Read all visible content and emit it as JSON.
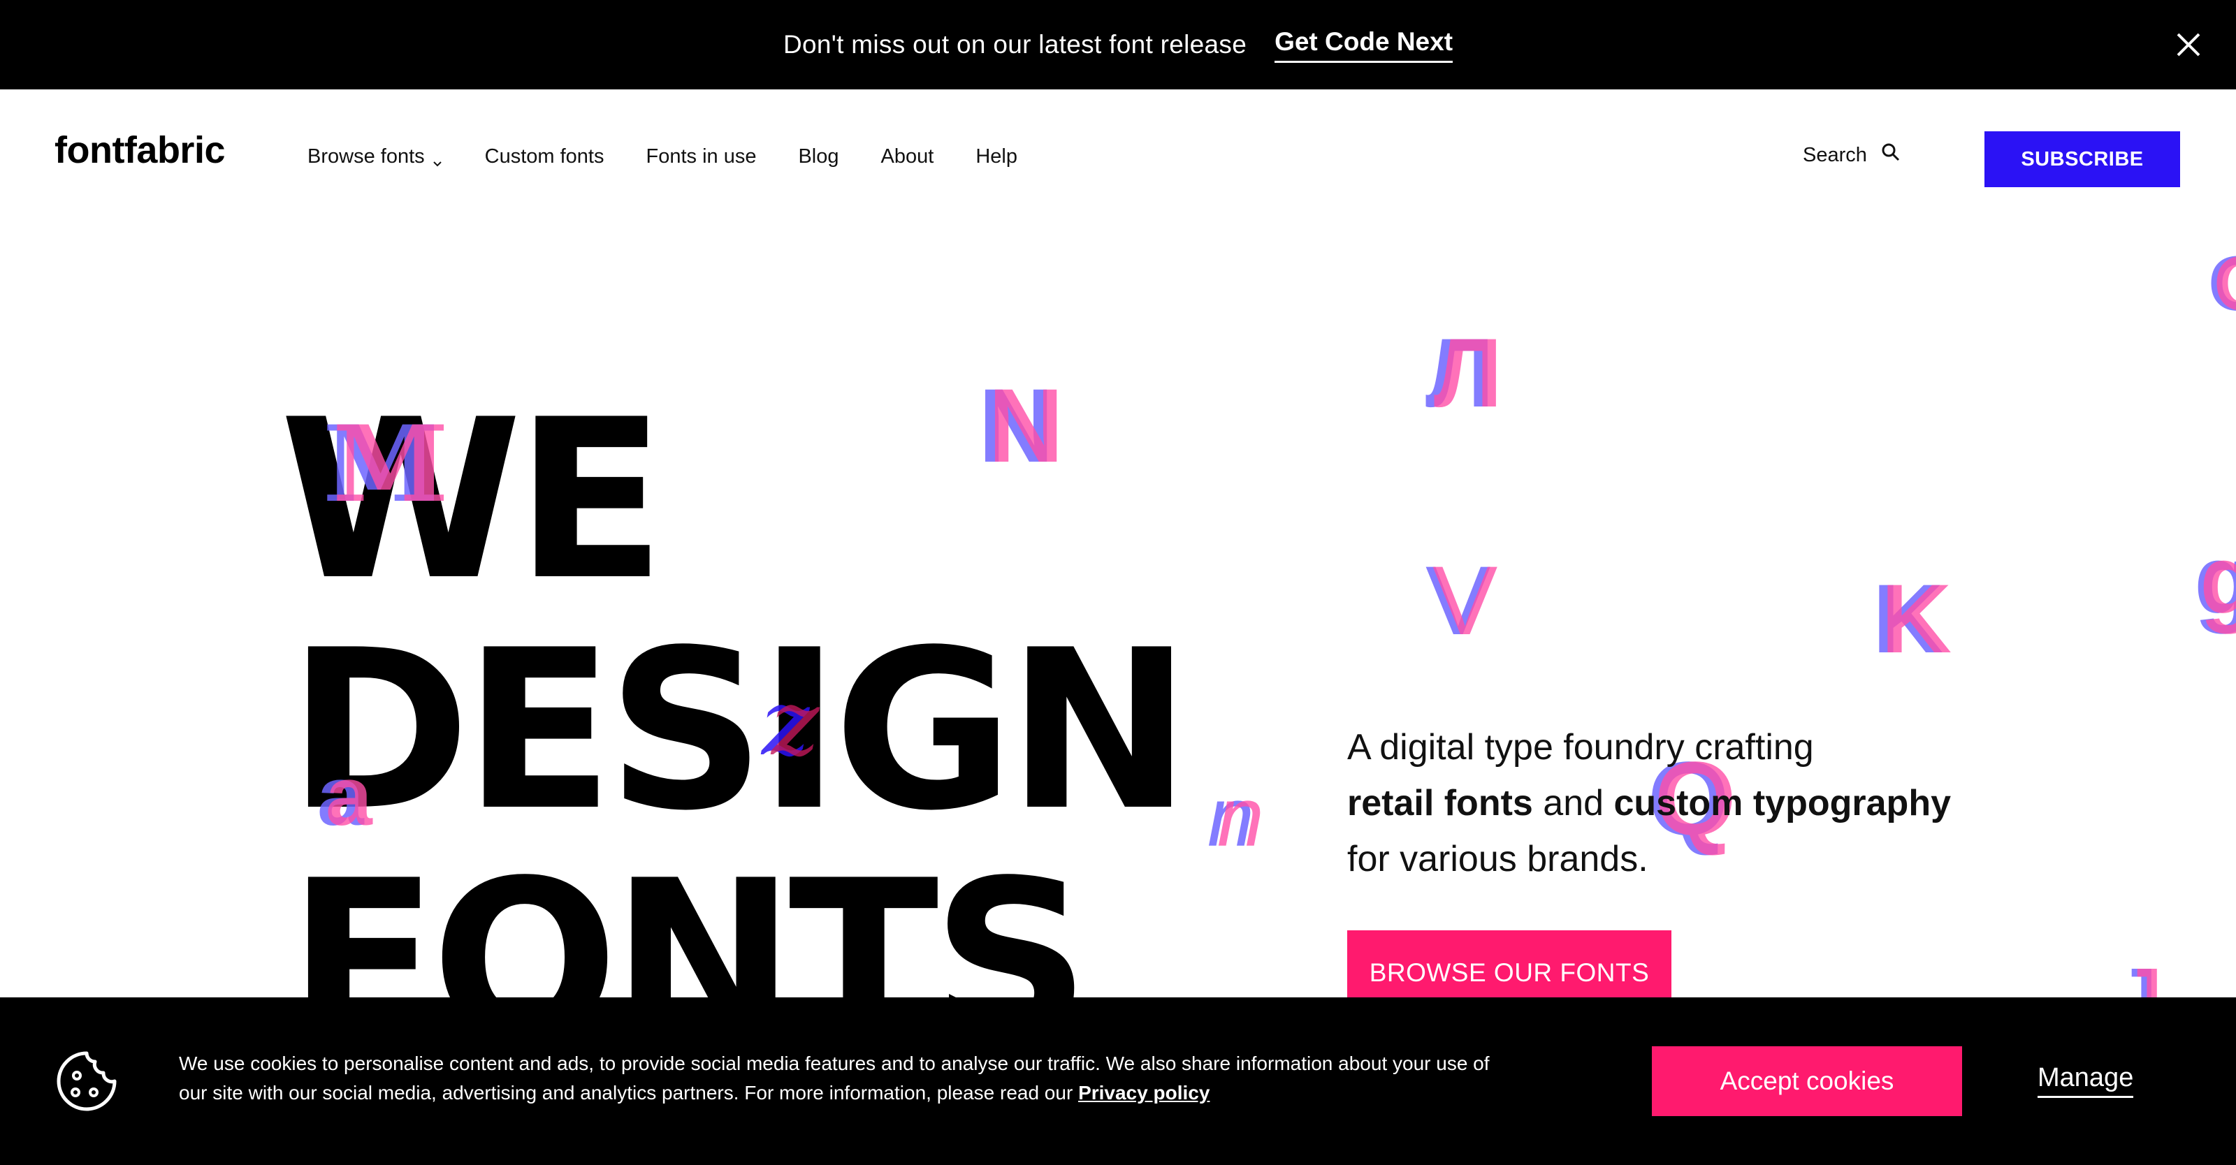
{
  "announcement": {
    "text": "Don't miss out on our latest font release",
    "link": "Get Code Next"
  },
  "header": {
    "logo": "fontfabric",
    "nav": [
      "Browse fonts",
      "Custom fonts",
      "Fonts in use",
      "Blog",
      "About",
      "Help"
    ],
    "search_label": "Search",
    "subscribe_label": "SUBSCRIBE"
  },
  "hero": {
    "headline": [
      "WE",
      "DESIGN",
      "FONTS"
    ],
    "tagline_part1": "A digital type foundry crafting",
    "tagline_bold1": "retail fonts",
    "tagline_and": "and",
    "tagline_bold2": "custom typography",
    "tagline_part3": "for various brands.",
    "cta_label": "BROWSE OUR FONTS",
    "floating_glyphs": [
      "M",
      "N",
      "Л",
      "V",
      "K",
      "Q",
      "a",
      "n",
      "z",
      "O",
      "g",
      "J"
    ]
  },
  "colors": {
    "accent_blue": "#2b12f5",
    "accent_pink": "#ff1a6e",
    "glyph_blue": "#6e66ff",
    "glyph_pink": "#ff4fa8"
  },
  "cookie": {
    "text_line1": "We use cookies to personalise content and ads, to provide social media features and to analyse our traffic. We also share information about your use of",
    "text_line2": "our site with our social media, advertising and analytics partners. For more information, please read our",
    "privacy_link": "Privacy policy",
    "accept_label": "Accept cookies",
    "manage_label": "Manage"
  }
}
